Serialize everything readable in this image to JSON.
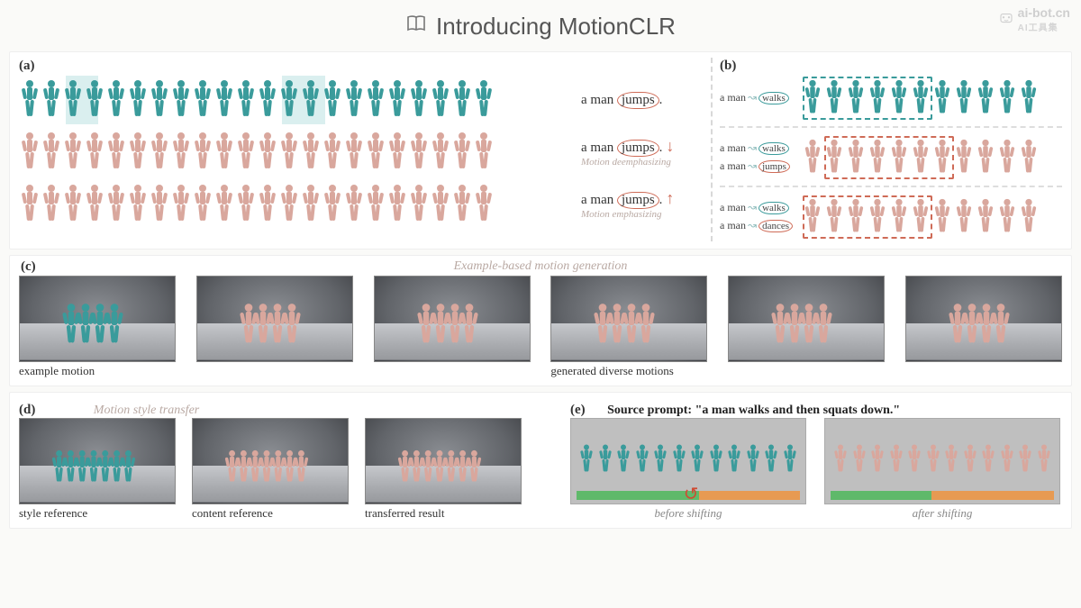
{
  "watermark": {
    "line1": "ai-bot.cn",
    "line2": "AI工具集"
  },
  "title": "Introducing MotionCLR",
  "panel_a": {
    "tag": "(a)",
    "rows": [
      {
        "prompt_prefix": "a man ",
        "prompt_word": "jumps",
        "prompt_suffix": ".",
        "sub": "",
        "color": "teal",
        "highlights": [
          [
            2,
            1.5
          ],
          [
            12,
            2
          ]
        ]
      },
      {
        "prompt_prefix": "a man ",
        "prompt_word": "jumps",
        "prompt_suffix": ".",
        "sub": "Motion deemphasizing",
        "arrow": "down",
        "color": "pink"
      },
      {
        "prompt_prefix": "a man ",
        "prompt_word": "jumps",
        "prompt_suffix": ".",
        "sub": "Motion emphasizing",
        "arrow": "up",
        "color": "pink"
      }
    ]
  },
  "panel_b": {
    "tag": "(b)",
    "rows": [
      {
        "prompts": [
          [
            "a man",
            "walks",
            "t"
          ]
        ],
        "dash": "tealb",
        "dash_span": [
          0,
          5
        ]
      },
      {
        "prompts": [
          [
            "a man",
            "walks",
            "t"
          ],
          [
            "a man",
            "jumps",
            "p"
          ]
        ],
        "dash": "pinkb",
        "dash_span": [
          1,
          6
        ]
      },
      {
        "prompts": [
          [
            "a man",
            "walks",
            "t"
          ],
          [
            "a man",
            "dances",
            "p"
          ]
        ],
        "dash": "pinkb",
        "dash_span": [
          0,
          5
        ]
      }
    ]
  },
  "panel_c": {
    "tag": "(c)",
    "title": "Example-based motion generation",
    "labels": [
      "example motion",
      "",
      "",
      "generated diverse motions",
      "",
      ""
    ],
    "colors": [
      "teal",
      "pink",
      "pink",
      "pink",
      "pink",
      "pink"
    ]
  },
  "panel_d": {
    "tag": "(d)",
    "title": "Motion style transfer",
    "items": [
      {
        "label": "style reference",
        "color": "teal"
      },
      {
        "label": "content reference",
        "color": "pink"
      },
      {
        "label": "transferred result",
        "color": "pink"
      }
    ]
  },
  "panel_e": {
    "tag": "(e)",
    "source_label": "Source prompt: ",
    "source_prompt": "\"a man walks and then squats down.\"",
    "cards": [
      {
        "label": "before shifting",
        "color": "teal",
        "bars": [
          55,
          45
        ],
        "swap": true
      },
      {
        "label": "after shifting",
        "color": "pink",
        "bars": [
          45,
          55
        ],
        "swap": false
      }
    ]
  }
}
